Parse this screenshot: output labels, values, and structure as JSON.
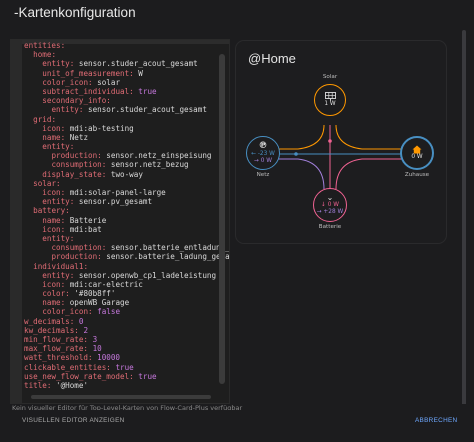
{
  "dialog": {
    "title": "-Kartenkonfiguration"
  },
  "editor": {
    "lines": [
      {
        "ind": "",
        "segs": [
          {
            "t": "entities:",
            "c": "k"
          }
        ]
      },
      {
        "ind": "  ",
        "segs": [
          {
            "t": "home:",
            "c": "k"
          }
        ]
      },
      {
        "ind": "    ",
        "segs": [
          {
            "t": "entity:",
            "c": "k"
          },
          {
            "t": " sensor.studer_acout_gesamt",
            "c": "s"
          }
        ]
      },
      {
        "ind": "    ",
        "segs": [
          {
            "t": "unit_of_measurement:",
            "c": "k"
          },
          {
            "t": " W",
            "c": "s"
          }
        ]
      },
      {
        "ind": "    ",
        "segs": [
          {
            "t": "color_icon:",
            "c": "k"
          },
          {
            "t": " solar",
            "c": "s"
          }
        ]
      },
      {
        "ind": "    ",
        "segs": [
          {
            "t": "subtract_individual:",
            "c": "k"
          },
          {
            "t": " true",
            "c": "n"
          }
        ]
      },
      {
        "ind": "    ",
        "segs": [
          {
            "t": "secondary_info:",
            "c": "k"
          }
        ]
      },
      {
        "ind": "      ",
        "segs": [
          {
            "t": "entity:",
            "c": "k"
          },
          {
            "t": " sensor.studer_acout_gesamt",
            "c": "s"
          }
        ]
      },
      {
        "ind": "  ",
        "segs": [
          {
            "t": "grid:",
            "c": "k"
          }
        ]
      },
      {
        "ind": "    ",
        "segs": [
          {
            "t": "icon:",
            "c": "k"
          },
          {
            "t": " mdi:ab-testing",
            "c": "s"
          }
        ]
      },
      {
        "ind": "    ",
        "segs": [
          {
            "t": "name:",
            "c": "k"
          },
          {
            "t": " Netz",
            "c": "s"
          }
        ]
      },
      {
        "ind": "    ",
        "segs": [
          {
            "t": "entity:",
            "c": "k"
          }
        ]
      },
      {
        "ind": "      ",
        "segs": [
          {
            "t": "production:",
            "c": "k"
          },
          {
            "t": " sensor.netz_einspeisung",
            "c": "s"
          }
        ]
      },
      {
        "ind": "      ",
        "segs": [
          {
            "t": "consumption:",
            "c": "k"
          },
          {
            "t": " sensor.netz_bezug",
            "c": "s"
          }
        ]
      },
      {
        "ind": "    ",
        "segs": [
          {
            "t": "display_state:",
            "c": "k"
          },
          {
            "t": " two-way",
            "c": "s"
          }
        ]
      },
      {
        "ind": "  ",
        "segs": [
          {
            "t": "solar:",
            "c": "k"
          }
        ]
      },
      {
        "ind": "    ",
        "segs": [
          {
            "t": "icon:",
            "c": "k"
          },
          {
            "t": " mdi:solar-panel-large",
            "c": "s"
          }
        ]
      },
      {
        "ind": "    ",
        "segs": [
          {
            "t": "entity:",
            "c": "k"
          },
          {
            "t": " sensor.pv_gesamt",
            "c": "s"
          }
        ]
      },
      {
        "ind": "  ",
        "segs": [
          {
            "t": "battery:",
            "c": "k"
          }
        ]
      },
      {
        "ind": "    ",
        "segs": [
          {
            "t": "name:",
            "c": "k"
          },
          {
            "t": " Batterie",
            "c": "s"
          }
        ]
      },
      {
        "ind": "    ",
        "segs": [
          {
            "t": "icon:",
            "c": "k"
          },
          {
            "t": " mdi:bat",
            "c": "s"
          }
        ]
      },
      {
        "ind": "    ",
        "segs": [
          {
            "t": "entity:",
            "c": "k"
          }
        ]
      },
      {
        "ind": "      ",
        "segs": [
          {
            "t": "consumption:",
            "c": "k"
          },
          {
            "t": " sensor.batterie_entladung_ge",
            "c": "s"
          }
        ]
      },
      {
        "ind": "      ",
        "segs": [
          {
            "t": "production:",
            "c": "k"
          },
          {
            "t": " sensor.batterie_ladung_gesam",
            "c": "s"
          }
        ]
      },
      {
        "ind": "  ",
        "segs": [
          {
            "t": "individual1:",
            "c": "k"
          }
        ]
      },
      {
        "ind": "    ",
        "segs": [
          {
            "t": "entity:",
            "c": "k"
          },
          {
            "t": " sensor.openwb_cp1_ladeleistung",
            "c": "s"
          }
        ]
      },
      {
        "ind": "    ",
        "segs": [
          {
            "t": "icon:",
            "c": "k"
          },
          {
            "t": " mdi:car-electric",
            "c": "s"
          }
        ]
      },
      {
        "ind": "    ",
        "segs": [
          {
            "t": "color:",
            "c": "k"
          },
          {
            "t": " '#80b8ff'",
            "c": "s"
          }
        ]
      },
      {
        "ind": "    ",
        "segs": [
          {
            "t": "name:",
            "c": "k"
          },
          {
            "t": " openWB Garage",
            "c": "s"
          }
        ]
      },
      {
        "ind": "    ",
        "segs": [
          {
            "t": "color_icon:",
            "c": "k"
          },
          {
            "t": " false",
            "c": "n"
          }
        ]
      },
      {
        "ind": "",
        "segs": [
          {
            "t": "w_decimals:",
            "c": "k"
          },
          {
            "t": " 0",
            "c": "n"
          }
        ]
      },
      {
        "ind": "",
        "segs": [
          {
            "t": "kw_decimals:",
            "c": "k"
          },
          {
            "t": " 2",
            "c": "n"
          }
        ]
      },
      {
        "ind": "",
        "segs": [
          {
            "t": "min_flow_rate:",
            "c": "k"
          },
          {
            "t": " 3",
            "c": "n"
          }
        ]
      },
      {
        "ind": "",
        "segs": [
          {
            "t": "max_flow_rate:",
            "c": "k"
          },
          {
            "t": " 10",
            "c": "n"
          }
        ]
      },
      {
        "ind": "",
        "segs": [
          {
            "t": "watt_threshold:",
            "c": "k"
          },
          {
            "t": " 10000",
            "c": "n"
          }
        ]
      },
      {
        "ind": "",
        "segs": [
          {
            "t": "clickable_entities:",
            "c": "k"
          },
          {
            "t": " true",
            "c": "n"
          }
        ]
      },
      {
        "ind": "",
        "segs": [
          {
            "t": "use_new_flow_rate_model:",
            "c": "k"
          },
          {
            "t": " true",
            "c": "n"
          }
        ]
      },
      {
        "ind": "",
        "segs": [
          {
            "t": "title:",
            "c": "k"
          },
          {
            "t": " '@Home'",
            "c": "s"
          }
        ]
      }
    ]
  },
  "card": {
    "title": "@Home",
    "solar": {
      "label": "Solar",
      "value": "1 W",
      "icon": "solar-panel-icon",
      "color": "#ff9800"
    },
    "grid": {
      "label": "Netz",
      "value_out": "← -23 W",
      "value_in": "→ 0 W",
      "icon": "ab-testing-icon",
      "color": "#488fc2"
    },
    "home": {
      "label": "Zuhause",
      "value": "0 W",
      "icon": "home-icon",
      "color": "#488fc2"
    },
    "battery": {
      "label": "Batterie",
      "value_out": "↓ 0 W",
      "value_in": "→ +28 W",
      "icon": "battery-icon",
      "color": "#f06292"
    }
  },
  "colors": {
    "solar": "#ff9800",
    "grid": "#488fc2",
    "battery": "#f06292",
    "battery_in": "#a280db",
    "key": "#e06c75",
    "number": "#c678dd",
    "accent": "#6ea8ff"
  },
  "footer": {
    "hint": "Kein visueller Editor für Top-Level-Karten von Flow-Card-Plus verfügbar",
    "show_editor_button": "VISUELLEN EDITOR ANZEIGEN",
    "cancel_button": "ABBRECHEN"
  }
}
